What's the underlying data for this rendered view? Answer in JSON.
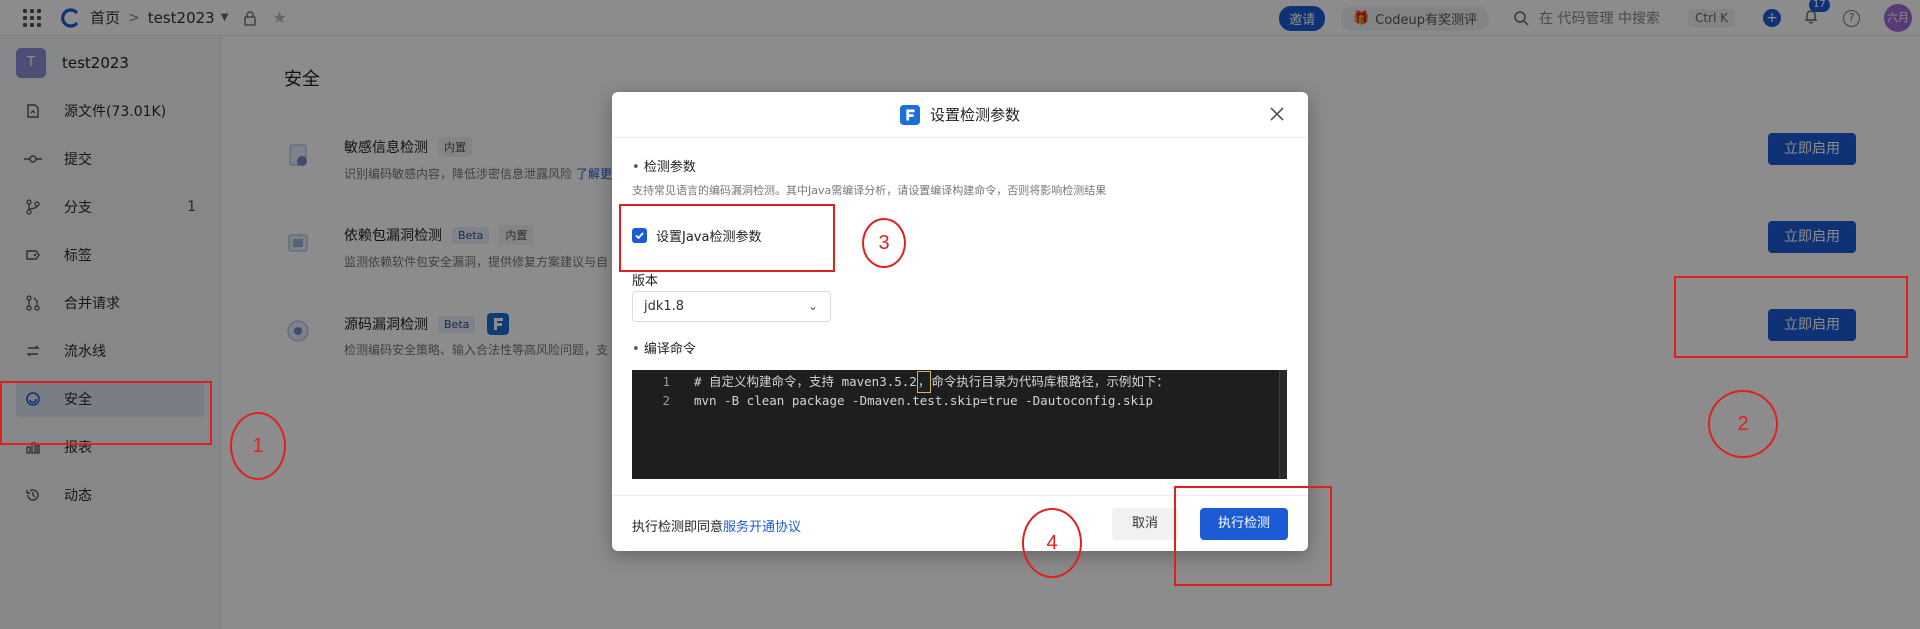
{
  "topbar": {
    "home": "首页",
    "repo": "test2023",
    "invite": "邀请",
    "codeup": "Codeup有奖测评",
    "search_placeholder": "在 代码管理 中搜索",
    "shortcut": "Ctrl K",
    "notification_count": "17",
    "help": "?",
    "user": "六月"
  },
  "sidebar": {
    "repo_initial": "T",
    "repo_name": "test2023",
    "items": [
      {
        "label": "源文件(73.01K)",
        "icon": "file-icon"
      },
      {
        "label": "提交",
        "icon": "commit-icon"
      },
      {
        "label": "分支",
        "icon": "branch-icon",
        "count": "1"
      },
      {
        "label": "标签",
        "icon": "tag-icon"
      },
      {
        "label": "合并请求",
        "icon": "merge-request-icon"
      },
      {
        "label": "流水线",
        "icon": "pipeline-icon"
      },
      {
        "label": "安全",
        "icon": "security-icon",
        "active": true
      },
      {
        "label": "报表",
        "icon": "report-icon"
      },
      {
        "label": "动态",
        "icon": "activity-icon"
      }
    ]
  },
  "main": {
    "title": "安全",
    "services": [
      {
        "name": "敏感信息检测",
        "tags": [
          "内置"
        ],
        "desc": "识别编码敏感内容，降低涉密信息泄露风险",
        "more": "了解更",
        "action": "立即启用"
      },
      {
        "name": "依赖包漏洞检测",
        "tags": [
          "Beta",
          "内置"
        ],
        "desc": "监测依赖软件包安全漏洞，提供修复方案建议与自",
        "action": "立即启用"
      },
      {
        "name": "源码漏洞检测",
        "tags": [
          "Beta"
        ],
        "desc": "检测编码安全策略、输入合法性等高风险问题，支",
        "action": "立即启用"
      }
    ]
  },
  "modal": {
    "title": "设置检测参数",
    "section1": "检测参数",
    "section1_desc": "支持常见语言的编码漏洞检测。其中Java需编译分析，请设置编译构建命令，否则将影响检测结果",
    "checkbox_label": "设置Java检测参数",
    "version_label": "版本",
    "version_value": "jdk1.8",
    "section2": "编译命令",
    "code_lines": [
      {
        "no": "1",
        "pre": "# 自定义构建命令，支持 maven3.5.2",
        "mark": "，",
        "post": "命令执行目录为代码库根路径，示例如下："
      },
      {
        "no": "2",
        "pre": "mvn -B clean package -Dmaven.test.skip=true -Dautoconfig.skip",
        "mark": "",
        "post": ""
      }
    ],
    "agree_prefix": "执行检测即同意",
    "agree_link": "服务开通协议",
    "cancel": "取消",
    "run": "执行检测"
  },
  "annotations": [
    "1",
    "2",
    "3",
    "4"
  ],
  "colors": {
    "accent": "#1b5cd6",
    "annotation": "#e02020"
  }
}
